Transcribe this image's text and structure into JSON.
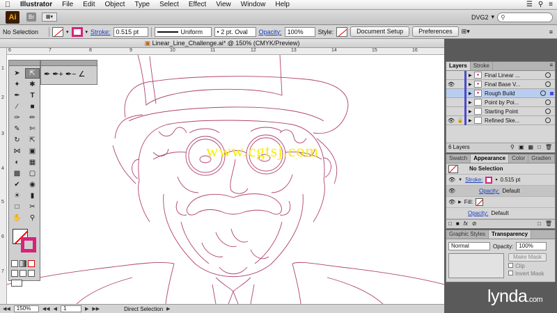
{
  "menubar": {
    "app": "Illustrator",
    "items": [
      "File",
      "Edit",
      "Object",
      "Type",
      "Select",
      "Effect",
      "View",
      "Window",
      "Help"
    ]
  },
  "appbar": {
    "logo": "Ai",
    "bridge": "Br",
    "workspace": "DVG2"
  },
  "control": {
    "selection": "No Selection",
    "stroke_label": "Stroke:",
    "stroke_weight": "0.515 pt",
    "profile": "Uniform",
    "brush": "2 pt. Oval",
    "opacity_label": "Opacity:",
    "opacity": "100%",
    "style_label": "Style:",
    "doc_setup": "Document Setup",
    "preferences": "Preferences"
  },
  "document": {
    "title": "Linear_Line_Challenge.ai* @ 150% (CMYK/Preview)"
  },
  "ruler_top_ticks": [
    "6",
    "7",
    "8",
    "9",
    "10",
    "11",
    "12",
    "13",
    "14",
    "15",
    "16"
  ],
  "ruler_left_ticks": [
    "1",
    "2",
    "3",
    "4",
    "5",
    "6",
    "7"
  ],
  "watermark": "www.cgtsj.com",
  "status": {
    "zoom": "150%",
    "artboard": "1",
    "tool": "Direct Selection"
  },
  "layers": {
    "tabs": [
      "Layers",
      "Stroke"
    ],
    "rows": [
      {
        "name": "Final Linear ...",
        "visible": false,
        "locked": false,
        "selected": false
      },
      {
        "name": "Final Base V...",
        "visible": true,
        "locked": false,
        "selected": false
      },
      {
        "name": "Rough Build",
        "visible": false,
        "locked": false,
        "selected": true
      },
      {
        "name": "Point by Poi...",
        "visible": false,
        "locked": false,
        "selected": false
      },
      {
        "name": "Starting Point",
        "visible": false,
        "locked": false,
        "selected": false
      },
      {
        "name": "Refined Ske...",
        "visible": true,
        "locked": true,
        "selected": false
      }
    ],
    "count": "6 Layers"
  },
  "appearance": {
    "tabs": [
      "Swatch",
      "Appearance",
      "Color",
      "Gradien"
    ],
    "title": "No Selection",
    "stroke_label": "Stroke:",
    "stroke_value": "0.515 pt",
    "opacity_label": "Opacity:",
    "opacity_value": "Default",
    "fill_label": "Fill:",
    "opacity2_label": "Opacity:",
    "opacity2_value": "Default"
  },
  "transparency": {
    "tabs": [
      "Graphic Styles",
      "Transparency"
    ],
    "mode": "Normal",
    "opacity_label": "Opacity:",
    "opacity": "100%",
    "make_mask": "Make Mask",
    "clip": "Clip",
    "invert": "Invert Mask"
  },
  "branding": "lynda",
  "colors": {
    "stroke_magenta": "#d6247a",
    "line_art": "#b0416f",
    "watermark": "#f7f000",
    "layer_bar": "#4a4ad0"
  }
}
